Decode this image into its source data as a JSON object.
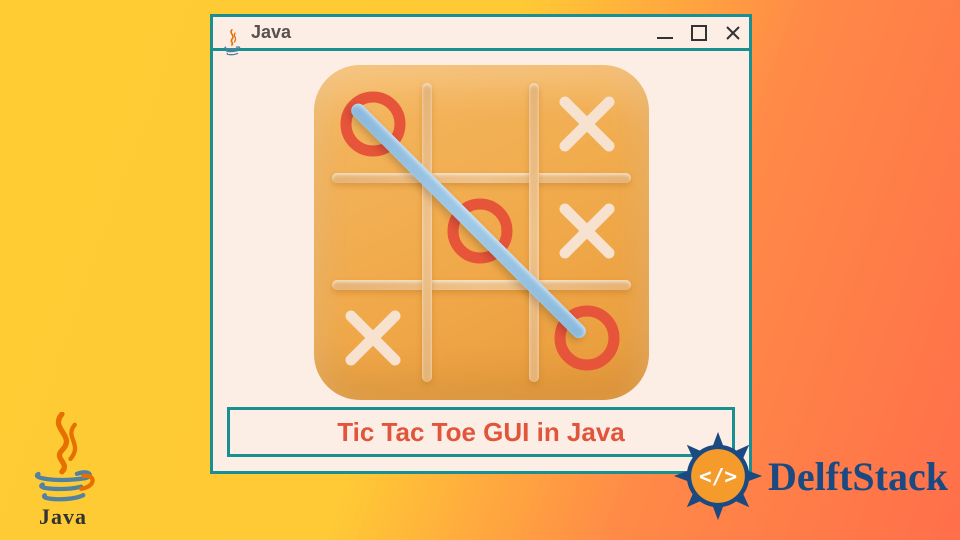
{
  "window": {
    "title": "Java"
  },
  "caption": {
    "text": "Tic Tac Toe GUI in Java"
  },
  "board": {
    "cells": [
      [
        "O",
        "",
        "X"
      ],
      [
        "",
        "O",
        "X"
      ],
      [
        "X",
        "",
        "O"
      ]
    ],
    "winner": "O",
    "win_line": "diagonal-tl-br"
  },
  "logos": {
    "java_label": "Java",
    "delftstack_label": "DelftStack"
  },
  "colors": {
    "window_border": "#1a8f91",
    "accent_red": "#e0553b",
    "bg_gradient_start": "#ffcc33",
    "bg_gradient_end": "#ff6f4a"
  },
  "icons": {
    "minimize": "minimize-icon",
    "maximize": "maximize-icon",
    "close": "close-icon",
    "java_cup": "java-cup-icon",
    "delftstack_badge": "delftstack-badge-icon"
  }
}
